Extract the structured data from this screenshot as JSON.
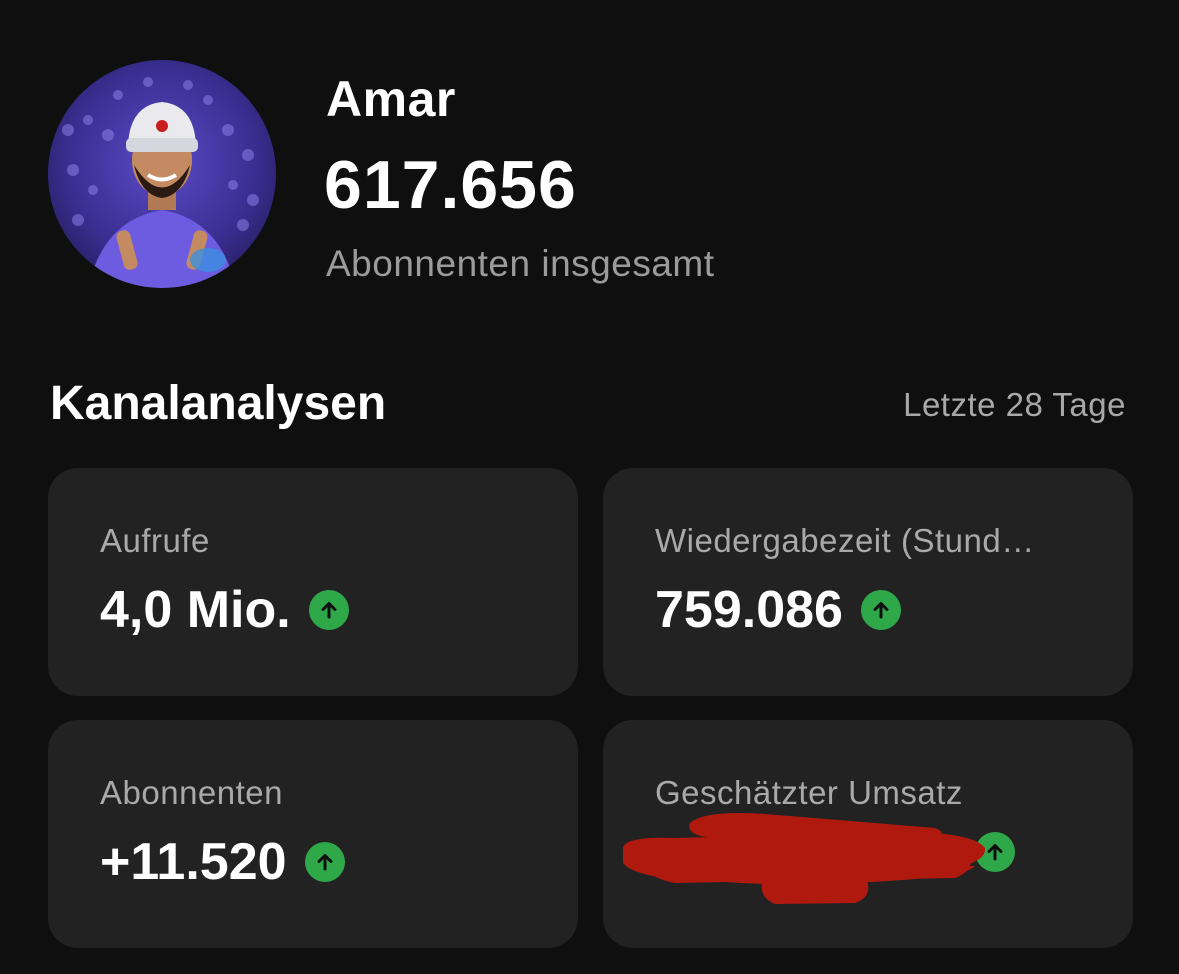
{
  "profile": {
    "name": "Amar",
    "subscriber_total": "617.656",
    "subscriber_label": "Abonnenten insgesamt"
  },
  "analytics": {
    "title": "Kanalanalysen",
    "period": "Letzte 28 Tage",
    "cards": [
      {
        "label": "Aufrufe",
        "value": "4,0 Mio.",
        "trend": "up"
      },
      {
        "label": "Wiedergabezeit (Stund…",
        "value": "759.086",
        "trend": "up"
      },
      {
        "label": "Abonnenten",
        "value": "+11.520",
        "trend": "up"
      },
      {
        "label": "Geschätzter Umsatz",
        "value": "",
        "trend": "up",
        "redacted": true
      }
    ]
  },
  "colors": {
    "background": "#0f0f10",
    "card": "#222223",
    "trend_up": "#2fa84a",
    "redaction": "#b01a0e"
  },
  "icons": [
    "avatar-photo",
    "arrow-up-icon"
  ]
}
